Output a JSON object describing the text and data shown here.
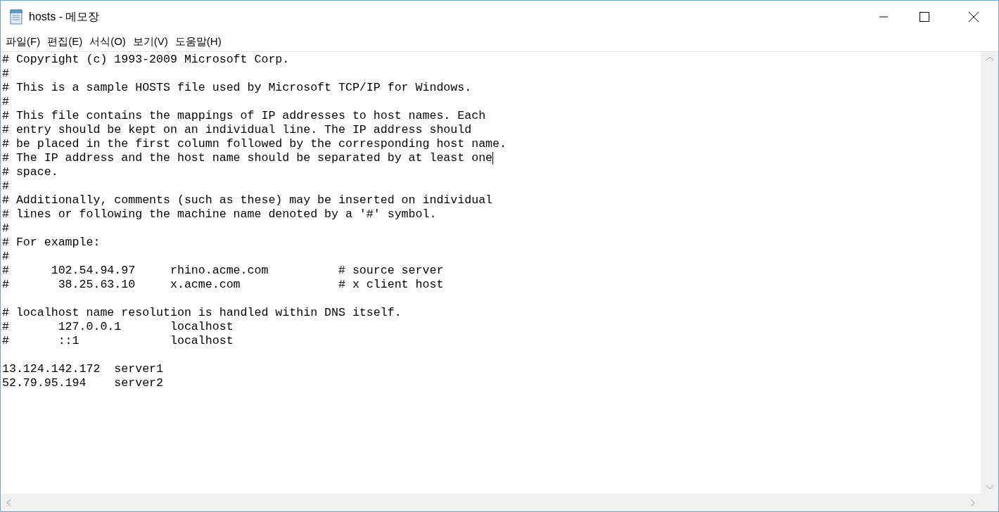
{
  "window": {
    "title": "hosts - 메모장"
  },
  "menu": [
    {
      "label": "파일(F)"
    },
    {
      "label": "편집(E)"
    },
    {
      "label": "서식(O)"
    },
    {
      "label": "보기(V)"
    },
    {
      "label": "도움말(H)"
    }
  ],
  "lines": [
    {
      "kind": "text",
      "text": "# Copyright (c) 1993-2009 Microsoft Corp.",
      "caret": false
    },
    {
      "kind": "text",
      "text": "#",
      "caret": false
    },
    {
      "kind": "text",
      "text": "# This is a sample HOSTS file used by Microsoft TCP/IP for Windows.",
      "caret": false
    },
    {
      "kind": "text",
      "text": "#",
      "caret": false
    },
    {
      "kind": "text",
      "text": "# This file contains the mappings of IP addresses to host names. Each",
      "caret": false
    },
    {
      "kind": "text",
      "text": "# entry should be kept on an individual line. The IP address should",
      "caret": false
    },
    {
      "kind": "text",
      "text": "# be placed in the first column followed by the corresponding host name.",
      "caret": false
    },
    {
      "kind": "text",
      "text": "# The IP address and the host name should be separated by at least one",
      "caret": true
    },
    {
      "kind": "text",
      "text": "# space.",
      "caret": false
    },
    {
      "kind": "text",
      "text": "#",
      "caret": false
    },
    {
      "kind": "text",
      "text": "# Additionally, comments (such as these) may be inserted on individual",
      "caret": false
    },
    {
      "kind": "text",
      "text": "# lines or following the machine name denoted by a '#' symbol.",
      "caret": false
    },
    {
      "kind": "text",
      "text": "#",
      "caret": false
    },
    {
      "kind": "text",
      "text": "# For example:",
      "caret": false
    },
    {
      "kind": "text",
      "text": "#",
      "caret": false
    },
    {
      "kind": "text",
      "text": "#      102.54.94.97     rhino.acme.com          # source server",
      "caret": false
    },
    {
      "kind": "text",
      "text": "#       38.25.63.10     x.acme.com              # x client host",
      "caret": false
    },
    {
      "kind": "blank"
    },
    {
      "kind": "text",
      "text": "# localhost name resolution is handled within DNS itself.",
      "caret": false
    },
    {
      "kind": "text",
      "text": "#       127.0.0.1       localhost",
      "caret": false
    },
    {
      "kind": "text",
      "text": "#       ::1             localhost",
      "caret": false
    },
    {
      "kind": "blank"
    },
    {
      "kind": "text",
      "text": "13.124.142.172  server1",
      "caret": false
    },
    {
      "kind": "text",
      "text": "52.79.95.194    server2",
      "caret": false
    }
  ]
}
